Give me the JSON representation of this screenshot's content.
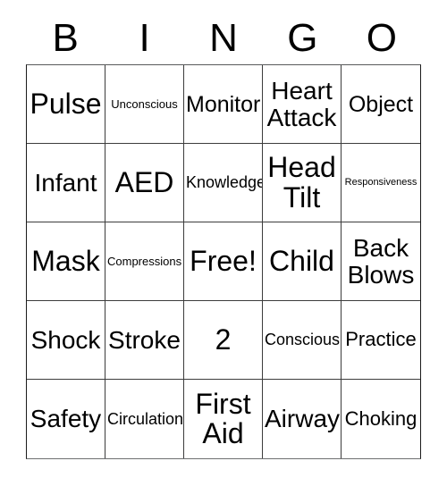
{
  "card": {
    "title": "BINGO",
    "header_letters": [
      "B",
      "I",
      "N",
      "G",
      "O"
    ],
    "free_space_label": "Free!",
    "colors": {
      "background": "#ffffff",
      "text": "#000000",
      "grid_line": "#3c3c3c",
      "outer_border": "#1a1a1a"
    },
    "grid": {
      "rows": 5,
      "columns": 5,
      "cells": [
        {
          "label": "Pulse",
          "size": "xxl",
          "free": false
        },
        {
          "label": "Unconscious",
          "size": "xs",
          "free": false
        },
        {
          "label": "Monitor",
          "size": "lg",
          "free": false
        },
        {
          "label": "Heart\nAttack",
          "size": "xl",
          "free": false
        },
        {
          "label": "Object",
          "size": "lg",
          "free": false
        },
        {
          "label": "Infant",
          "size": "xl",
          "free": false
        },
        {
          "label": "AED",
          "size": "xxl",
          "free": false
        },
        {
          "label": "Knowledge",
          "size": "sm",
          "free": false
        },
        {
          "label": "Head\nTilt",
          "size": "xxl",
          "free": false
        },
        {
          "label": "Responsiveness",
          "size": "xxs",
          "free": false
        },
        {
          "label": "Mask",
          "size": "xxl",
          "free": false
        },
        {
          "label": "Compressions",
          "size": "xs",
          "free": false
        },
        {
          "label": "Free!",
          "size": "xxl",
          "free": true
        },
        {
          "label": "Child",
          "size": "xxl",
          "free": false
        },
        {
          "label": "Back\nBlows",
          "size": "xl",
          "free": false
        },
        {
          "label": "Shock",
          "size": "xl",
          "free": false
        },
        {
          "label": "Stroke",
          "size": "xl",
          "free": false
        },
        {
          "label": "2",
          "size": "xxl",
          "free": false
        },
        {
          "label": "Conscious",
          "size": "sm",
          "free": false
        },
        {
          "label": "Practice",
          "size": "md",
          "free": false
        },
        {
          "label": "Safety",
          "size": "xl",
          "free": false
        },
        {
          "label": "Circulation",
          "size": "sm",
          "free": false
        },
        {
          "label": "First\nAid",
          "size": "xxl",
          "free": false
        },
        {
          "label": "Airway",
          "size": "xl",
          "free": false
        },
        {
          "label": "Choking",
          "size": "md",
          "free": false
        }
      ]
    }
  }
}
